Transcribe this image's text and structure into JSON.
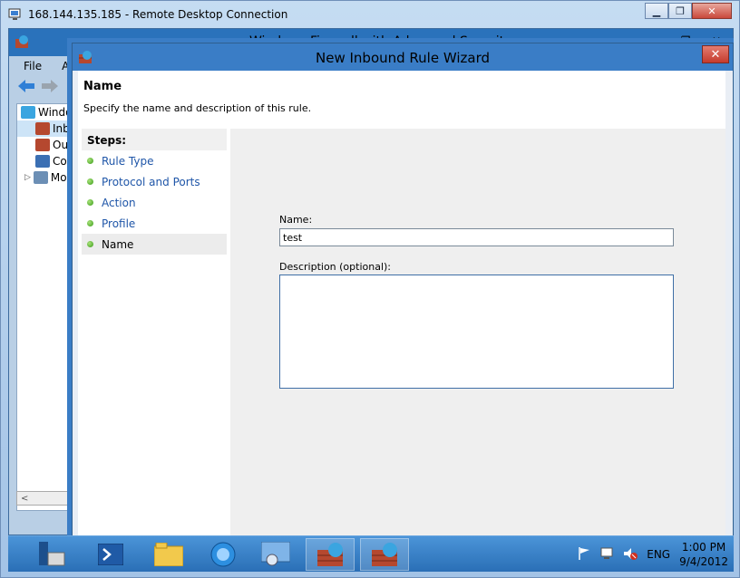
{
  "rdp": {
    "title": "168.144.135.185 - Remote Desktop Connection",
    "minimize": "▁",
    "restore": "❐",
    "close": "✕"
  },
  "mmc": {
    "title": "Windows Firewall with Advanced Security",
    "min": "▁",
    "max": "❐",
    "close": "✕",
    "menu": [
      "File",
      "Act"
    ],
    "tree": [
      "Windo",
      "Inb",
      "Out",
      "Cor",
      "Mo"
    ],
    "scroll_left": "<",
    "scroll_thumb": "⦀"
  },
  "wizard": {
    "title": "New Inbound Rule Wizard",
    "close": "✕",
    "header_title": "Name",
    "header_desc": "Specify the name and description of this rule.",
    "steps_title": "Steps:",
    "steps": [
      "Rule Type",
      "Protocol and Ports",
      "Action",
      "Profile",
      "Name"
    ],
    "name_label": "Name:",
    "name_value": "test",
    "desc_label": "Description (optional):",
    "desc_value": ""
  },
  "taskbar": {
    "lang": "ENG",
    "time": "1:00 PM",
    "date": "9/4/2012",
    "icons": [
      "server-manager-icon",
      "powershell-icon",
      "file-explorer-icon",
      "internet-explorer-icon",
      "control-panel-icon",
      "firewall-icon",
      "firewall-icon"
    ],
    "tray_icons": [
      "flag-icon",
      "network-icon",
      "volume-muted-icon"
    ]
  },
  "colors": {
    "taskbar": "#2a6fb6",
    "accent": "#3a7dc6",
    "link": "#1f56a8"
  }
}
